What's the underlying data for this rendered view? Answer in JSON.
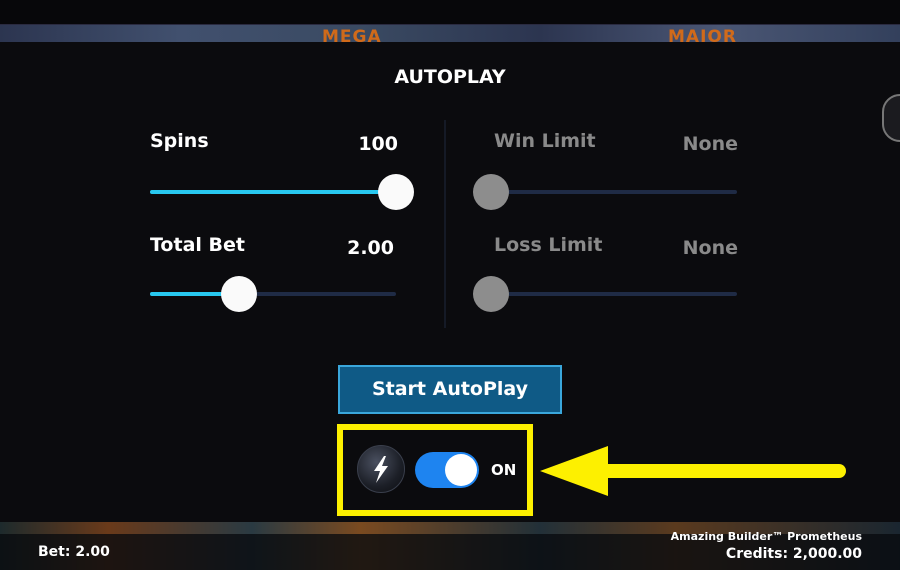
{
  "background": {
    "jackpots": [
      "MEGA",
      "MAJOR"
    ]
  },
  "dialog": {
    "title": "AUTOPLAY",
    "spins": {
      "label": "Spins",
      "value": "100",
      "level": 1.0
    },
    "total_bet": {
      "label": "Total Bet",
      "value": "2.00",
      "level": 0.36
    },
    "win_limit": {
      "label": "Win Limit",
      "value": "None",
      "level": 0.0
    },
    "loss_limit": {
      "label": "Loss Limit",
      "value": "None",
      "level": 0.0
    },
    "start_button": "Start AutoPlay",
    "turbo": {
      "icon": "lightning-icon",
      "state_label": "ON",
      "on": true
    }
  },
  "footer": {
    "bet": "Bet: 2.00",
    "game_name": "Amazing Builder™ Prometheus",
    "credits": "Credits: 2,000.00"
  },
  "colors": {
    "accent": "#28c8f0",
    "toggle_on": "#1e84f0",
    "button_bg": "#0f5a86",
    "highlight": "#fdf000"
  }
}
